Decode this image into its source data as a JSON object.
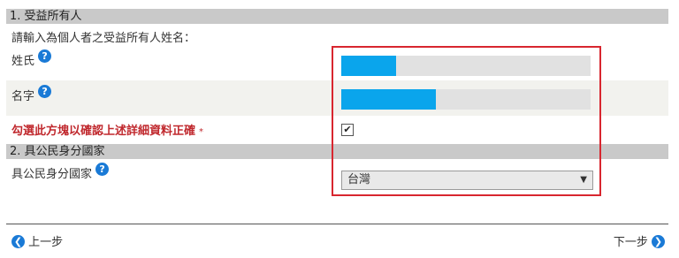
{
  "section1": {
    "title": "1. 受益所有人",
    "instruction": "請輸入為個人者之受益所有人姓名：",
    "surname_label": "姓氏",
    "surname_fill_fraction": 0.22,
    "given_name_label": "名字",
    "given_name_fill_fraction": 0.38,
    "confirm_text": "勾選此方塊以確認上述詳細資料正確",
    "confirm_required_mark": "*",
    "confirm_checked": true
  },
  "section2": {
    "title": "2. 具公民身分國家",
    "country_label": "具公民身分國家",
    "country_value": "台灣"
  },
  "nav": {
    "prev_label": "上一步",
    "next_label": "下一步"
  },
  "icons": {
    "help": "question-circle-icon",
    "prev": "chevron-left-circle-icon",
    "next": "chevron-right-circle-icon"
  },
  "colors": {
    "accent": "#1a7ad6",
    "fill": "#0aa5ec",
    "required_text": "#c0282d",
    "highlight": "#d8262f"
  }
}
